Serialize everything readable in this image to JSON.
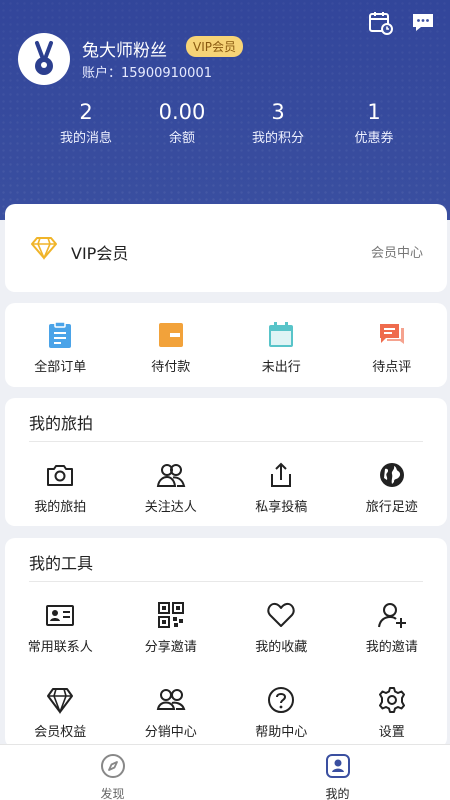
{
  "profile": {
    "name": "兔大师粉丝",
    "vip_badge": "VIP会员",
    "account": "账户：15900910001"
  },
  "stats": [
    {
      "value": "2",
      "label": "我的消息"
    },
    {
      "value": "0.00",
      "label": "余额"
    },
    {
      "value": "3",
      "label": "我的积分"
    },
    {
      "value": "1",
      "label": "优惠券"
    }
  ],
  "vip": {
    "title": "VIP会员",
    "center_link": "会员中心"
  },
  "orders": [
    {
      "label": "全部订单",
      "icon": "clipboard-icon",
      "color": "#4aa3e8"
    },
    {
      "label": "待付款",
      "icon": "wallet-icon",
      "color": "#f2a23a"
    },
    {
      "label": "未出行",
      "icon": "calendar-icon",
      "color": "#58c4c9"
    },
    {
      "label": "待点评",
      "icon": "comment-icon",
      "color": "#ef6b4d"
    }
  ],
  "travel": {
    "title": "我的旅拍",
    "items": [
      {
        "label": "我的旅拍",
        "icon": "camera-icon"
      },
      {
        "label": "关注达人",
        "icon": "people-icon"
      },
      {
        "label": "私享投稿",
        "icon": "upload-icon"
      },
      {
        "label": "旅行足迹",
        "icon": "globe-icon"
      }
    ]
  },
  "tools": {
    "title": "我的工具",
    "items": [
      {
        "label": "常用联系人",
        "icon": "contact-card-icon"
      },
      {
        "label": "分享邀请",
        "icon": "qrcode-icon"
      },
      {
        "label": "我的收藏",
        "icon": "heart-icon"
      },
      {
        "label": "我的邀请",
        "icon": "add-user-icon"
      },
      {
        "label": "会员权益",
        "icon": "diamond-icon"
      },
      {
        "label": "分销中心",
        "icon": "group-icon"
      },
      {
        "label": "帮助中心",
        "icon": "help-icon"
      },
      {
        "label": "设置",
        "icon": "gear-icon"
      }
    ]
  },
  "tabbar": [
    {
      "label": "发现",
      "icon": "compass-icon",
      "active": false
    },
    {
      "label": "我的",
      "icon": "profile-icon",
      "active": true
    }
  ],
  "colors": {
    "header": "#3a4fa0",
    "vip_gold": "#f0b429",
    "tab_active": "#3a4fa0",
    "tab_inactive": "#888888"
  }
}
